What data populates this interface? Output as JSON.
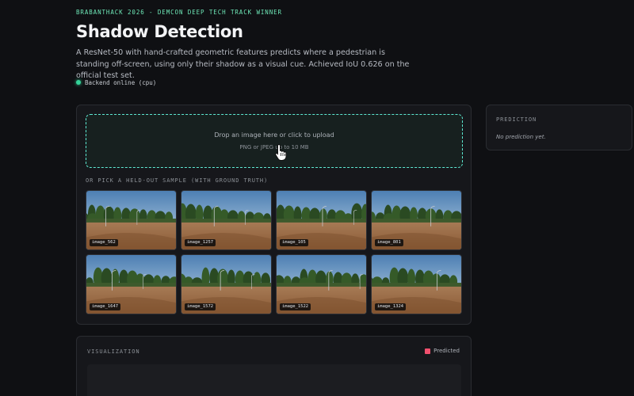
{
  "header": {
    "kicker": "BRABANTHACK 2026 - DEMCON DEEP TECH TRACK WINNER",
    "title": "Shadow Detection",
    "description": "A ResNet-50 with hand-crafted geometric features predicts where a pedestrian is standing off-screen, using only their shadow as a visual cue. Achieved IoU 0.626 on the official test set.",
    "status": "Backend online (cpu)",
    "status_color": "#34d399"
  },
  "upload": {
    "title": "Drop an image here or click to upload",
    "subtitle": "PNG or JPEG up to 10 MB",
    "accent": "#5eead4",
    "cursor_icon": "hand-pointer-icon"
  },
  "samples": {
    "label": "OR PICK A HELD-OUT SAMPLE (WITH GROUND TRUTH)",
    "items": [
      {
        "label": "image_562"
      },
      {
        "label": "image_1257"
      },
      {
        "label": "image_105"
      },
      {
        "label": "image_801"
      },
      {
        "label": "image_1647"
      },
      {
        "label": "image_1572"
      },
      {
        "label": "image_1522"
      },
      {
        "label": "image_1324"
      }
    ]
  },
  "prediction": {
    "label": "PREDICTION",
    "empty_text": "No prediction yet."
  },
  "visualization": {
    "label": "VISUALIZATION",
    "legend": "Predicted",
    "legend_color": "#f0506e"
  }
}
